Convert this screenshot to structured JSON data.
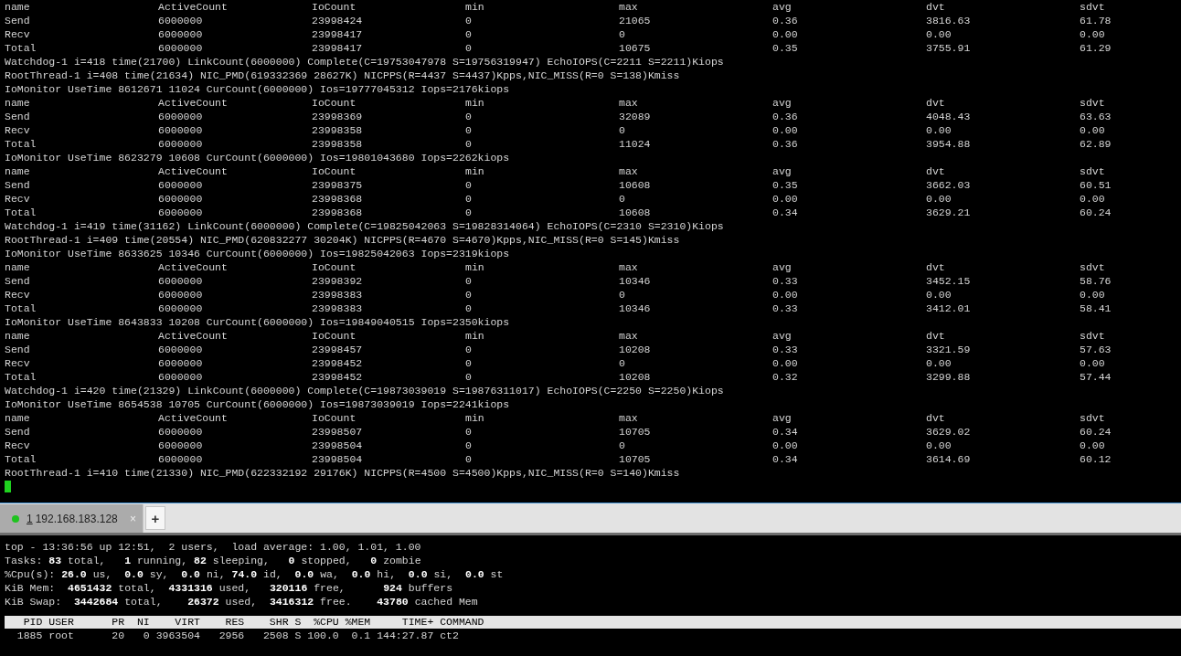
{
  "log_pane": {
    "blocks": [
      {
        "kind": "table",
        "columns": [
          "name",
          "ActiveCount",
          "IoCount",
          "min",
          "max",
          "avg",
          "dvt",
          "sdvt"
        ],
        "rows": [
          [
            "Send",
            "6000000",
            "23998424",
            "0",
            "21065",
            "0.36",
            "3816.63",
            "61.78"
          ],
          [
            "Recv",
            "6000000",
            "23998417",
            "0",
            "0",
            "0.00",
            "0.00",
            "0.00"
          ],
          [
            "Total",
            "6000000",
            "23998417",
            "0",
            "10675",
            "0.35",
            "3755.91",
            "61.29"
          ]
        ]
      },
      {
        "kind": "log",
        "text": "Watchdog-1 i=418 time(21700) LinkCount(6000000) Complete(C=19753047978 S=19756319947) EchoIOPS(C=2211 S=2211)Kiops"
      },
      {
        "kind": "log",
        "text": "RootThread-1 i=408 time(21634) NIC_PMD(619332369 28627K) NICPPS(R=4437 S=4437)Kpps,NIC_MISS(R=0 S=138)Kmiss"
      },
      {
        "kind": "log",
        "text": "IoMonitor UseTime 8612671 11024 CurCount(6000000) Ios=19777045312 Iops=2176kiops"
      },
      {
        "kind": "table",
        "columns": [
          "name",
          "ActiveCount",
          "IoCount",
          "min",
          "max",
          "avg",
          "dvt",
          "sdvt"
        ],
        "rows": [
          [
            "Send",
            "6000000",
            "23998369",
            "0",
            "32089",
            "0.36",
            "4048.43",
            "63.63"
          ],
          [
            "Recv",
            "6000000",
            "23998358",
            "0",
            "0",
            "0.00",
            "0.00",
            "0.00"
          ],
          [
            "Total",
            "6000000",
            "23998358",
            "0",
            "11024",
            "0.36",
            "3954.88",
            "62.89"
          ]
        ]
      },
      {
        "kind": "log",
        "text": "IoMonitor UseTime 8623279 10608 CurCount(6000000) Ios=19801043680 Iops=2262kiops"
      },
      {
        "kind": "table",
        "columns": [
          "name",
          "ActiveCount",
          "IoCount",
          "min",
          "max",
          "avg",
          "dvt",
          "sdvt"
        ],
        "rows": [
          [
            "Send",
            "6000000",
            "23998375",
            "0",
            "10608",
            "0.35",
            "3662.03",
            "60.51"
          ],
          [
            "Recv",
            "6000000",
            "23998368",
            "0",
            "0",
            "0.00",
            "0.00",
            "0.00"
          ],
          [
            "Total",
            "6000000",
            "23998368",
            "0",
            "10608",
            "0.34",
            "3629.21",
            "60.24"
          ]
        ]
      },
      {
        "kind": "log",
        "text": "Watchdog-1 i=419 time(31162) LinkCount(6000000) Complete(C=19825042063 S=19828314064) EchoIOPS(C=2310 S=2310)Kiops"
      },
      {
        "kind": "log",
        "text": "RootThread-1 i=409 time(20554) NIC_PMD(620832277 30204K) NICPPS(R=4670 S=4670)Kpps,NIC_MISS(R=0 S=145)Kmiss"
      },
      {
        "kind": "log",
        "text": "IoMonitor UseTime 8633625 10346 CurCount(6000000) Ios=19825042063 Iops=2319kiops"
      },
      {
        "kind": "table",
        "columns": [
          "name",
          "ActiveCount",
          "IoCount",
          "min",
          "max",
          "avg",
          "dvt",
          "sdvt"
        ],
        "rows": [
          [
            "Send",
            "6000000",
            "23998392",
            "0",
            "10346",
            "0.33",
            "3452.15",
            "58.76"
          ],
          [
            "Recv",
            "6000000",
            "23998383",
            "0",
            "0",
            "0.00",
            "0.00",
            "0.00"
          ],
          [
            "Total",
            "6000000",
            "23998383",
            "0",
            "10346",
            "0.33",
            "3412.01",
            "58.41"
          ]
        ]
      },
      {
        "kind": "log",
        "text": "IoMonitor UseTime 8643833 10208 CurCount(6000000) Ios=19849040515 Iops=2350kiops"
      },
      {
        "kind": "table",
        "columns": [
          "name",
          "ActiveCount",
          "IoCount",
          "min",
          "max",
          "avg",
          "dvt",
          "sdvt"
        ],
        "rows": [
          [
            "Send",
            "6000000",
            "23998457",
            "0",
            "10208",
            "0.33",
            "3321.59",
            "57.63"
          ],
          [
            "Recv",
            "6000000",
            "23998452",
            "0",
            "0",
            "0.00",
            "0.00",
            "0.00"
          ],
          [
            "Total",
            "6000000",
            "23998452",
            "0",
            "10208",
            "0.32",
            "3299.88",
            "57.44"
          ]
        ]
      },
      {
        "kind": "log",
        "text": "Watchdog-1 i=420 time(21329) LinkCount(6000000) Complete(C=19873039019 S=19876311017) EchoIOPS(C=2250 S=2250)Kiops"
      },
      {
        "kind": "log",
        "text": "IoMonitor UseTime 8654538 10705 CurCount(6000000) Ios=19873039019 Iops=2241kiops"
      },
      {
        "kind": "table",
        "columns": [
          "name",
          "ActiveCount",
          "IoCount",
          "min",
          "max",
          "avg",
          "dvt",
          "sdvt"
        ],
        "rows": [
          [
            "Send",
            "6000000",
            "23998507",
            "0",
            "10705",
            "0.34",
            "3629.02",
            "60.24"
          ],
          [
            "Recv",
            "6000000",
            "23998504",
            "0",
            "0",
            "0.00",
            "0.00",
            "0.00"
          ],
          [
            "Total",
            "6000000",
            "23998504",
            "0",
            "10705",
            "0.34",
            "3614.69",
            "60.12"
          ]
        ]
      },
      {
        "kind": "log",
        "text": "RootThread-1 i=410 time(21330) NIC_PMD(622332192 29176K) NICPPS(R=4500 S=4500)Kpps,NIC_MISS(R=0 S=140)Kmiss"
      }
    ]
  },
  "tabs": [
    {
      "number": "1",
      "host": "192.168.183.128",
      "connected": true,
      "selected": true,
      "close": "×"
    }
  ],
  "new_tab_button": "+",
  "top_pane": {
    "summary_lines": [
      "top - 13:36:56 up 12:51,  2 users,  load average: 1.00, 1.01, 1.00",
      "Tasks: **83** total,   **1** running, **82** sleeping,   **0** stopped,   **0** zombie",
      "%Cpu(s): **26.0** us,  **0.0** sy,  **0.0** ni, **74.0** id,  **0.0** wa,  **0.0** hi,  **0.0** si,  **0.0** st",
      "KiB Mem:  **4651432** total,  **4331316** used,   **320116** free,      **924** buffers",
      "KiB Swap:  **3442684** total,    **26372** used,  **3416312** free.    **43780** cached Mem"
    ],
    "process_header": "   PID USER      PR  NI    VIRT    RES    SHR S  %CPU %MEM     TIME+ COMMAND",
    "processes": [
      "  1885 root      20   0 3963504   2956   2508 S 100.0  0.1 144:27.87 ct2"
    ]
  }
}
